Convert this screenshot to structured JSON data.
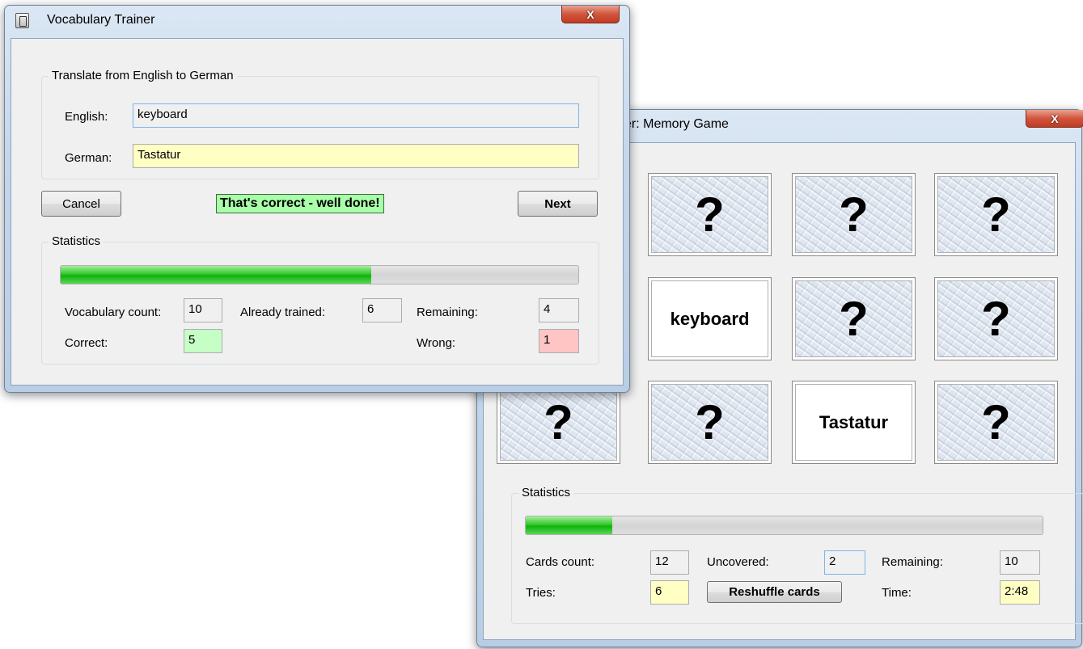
{
  "trainer": {
    "title": "Vocabulary Trainer",
    "close_label": "X",
    "translate_group": {
      "legend": "Translate from English to German",
      "english_label": "English:",
      "english_value": "keyboard",
      "german_label": "German:",
      "german_value": "Tastatur"
    },
    "cancel_label": "Cancel",
    "status_message": "That's correct - well done!",
    "next_label": "Next",
    "statistics": {
      "legend": "Statistics",
      "progress": 0.6,
      "vocab_count_label": "Vocabulary count:",
      "vocab_count": "10",
      "already_trained_label": "Already trained:",
      "already_trained": "6",
      "remaining_label": "Remaining:",
      "remaining": "4",
      "correct_label": "Correct:",
      "correct": "5",
      "wrong_label": "Wrong:",
      "wrong": "1"
    },
    "colors": {
      "correct_bg": "#c6ffc6",
      "wrong_bg": "#ffc4c4",
      "status_bg": "#a9ffa9"
    }
  },
  "memory": {
    "title": "er: Memory Game",
    "close_label": "X",
    "cards": [
      {
        "state": "hidden",
        "text": "?"
      },
      {
        "state": "hidden",
        "text": "?"
      },
      {
        "state": "hidden",
        "text": "?"
      },
      {
        "state": "hidden",
        "text": "?"
      },
      {
        "state": "hidden",
        "text": "?"
      },
      {
        "state": "revealed",
        "text": "keyboard"
      },
      {
        "state": "hidden",
        "text": "?"
      },
      {
        "state": "hidden",
        "text": "?"
      },
      {
        "state": "hidden",
        "text": "?"
      },
      {
        "state": "hidden",
        "text": "?"
      },
      {
        "state": "revealed",
        "text": "Tastatur"
      },
      {
        "state": "hidden",
        "text": "?"
      }
    ],
    "statistics": {
      "legend": "Statistics",
      "progress": 0.167,
      "cards_count_label": "Cards count:",
      "cards_count": "12",
      "uncovered_label": "Uncovered:",
      "uncovered": "2",
      "remaining_label": "Remaining:",
      "remaining": "10",
      "tries_label": "Tries:",
      "tries": "6",
      "reshuffle_label": "Reshuffle cards",
      "time_label": "Time:",
      "time": "2:48"
    }
  }
}
